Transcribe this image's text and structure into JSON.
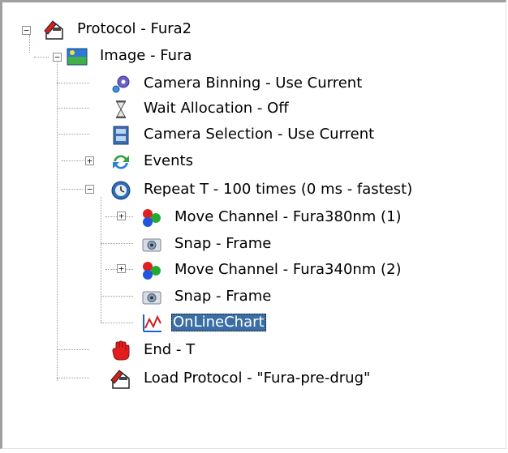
{
  "tree": {
    "items": [
      {
        "label": "Protocol - Fura2",
        "icon": "protocol-icon",
        "expanded": true
      },
      {
        "label": "Image - Fura",
        "icon": "image-icon",
        "expanded": true
      },
      {
        "label": "Camera Binning - Use Current",
        "icon": "camera-binning-icon"
      },
      {
        "label": "Wait Allocation - Off",
        "icon": "hourglass-icon"
      },
      {
        "label": "Camera Selection - Use Current",
        "icon": "camera-selection-icon"
      },
      {
        "label": "Events",
        "icon": "events-icon",
        "expanded": false
      },
      {
        "label": "Repeat T - 100 times (0 ms - fastest)",
        "icon": "repeat-clock-icon",
        "expanded": true
      },
      {
        "label": "Move Channel - Fura380nm (1)",
        "icon": "rgb-channel-icon",
        "expanded": false
      },
      {
        "label": "Snap - Frame",
        "icon": "snap-camera-icon"
      },
      {
        "label": "Move Channel - Fura340nm (2)",
        "icon": "rgb-channel-icon",
        "expanded": false
      },
      {
        "label": "Snap - Frame",
        "icon": "snap-camera-icon"
      },
      {
        "label": "OnLineChart",
        "icon": "online-chart-icon",
        "selected": true
      },
      {
        "label": "End - T",
        "icon": "stop-hand-icon"
      },
      {
        "label": "Load Protocol - \"Fura-pre-drug\"",
        "icon": "load-protocol-icon"
      }
    ]
  },
  "colors": {
    "selection": "#3a6ea5",
    "tree_lines": "#9a9a9a"
  }
}
